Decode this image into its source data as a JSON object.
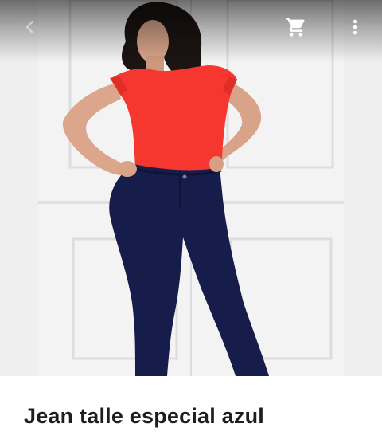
{
  "product": {
    "title": "Jean talle especial azul",
    "image_alt": "Mujer con remera roja y jean azul oscuro de talle especial"
  },
  "topbar": {
    "back_icon": "arrow-back-icon",
    "cart_icon": "shopping-cart-icon",
    "more_icon": "more-vert-icon"
  },
  "colors": {
    "shirt": "#f5372f",
    "jeans": "#161d4a",
    "background": "#f1f1f2",
    "title_text": "#1e1e1e"
  }
}
